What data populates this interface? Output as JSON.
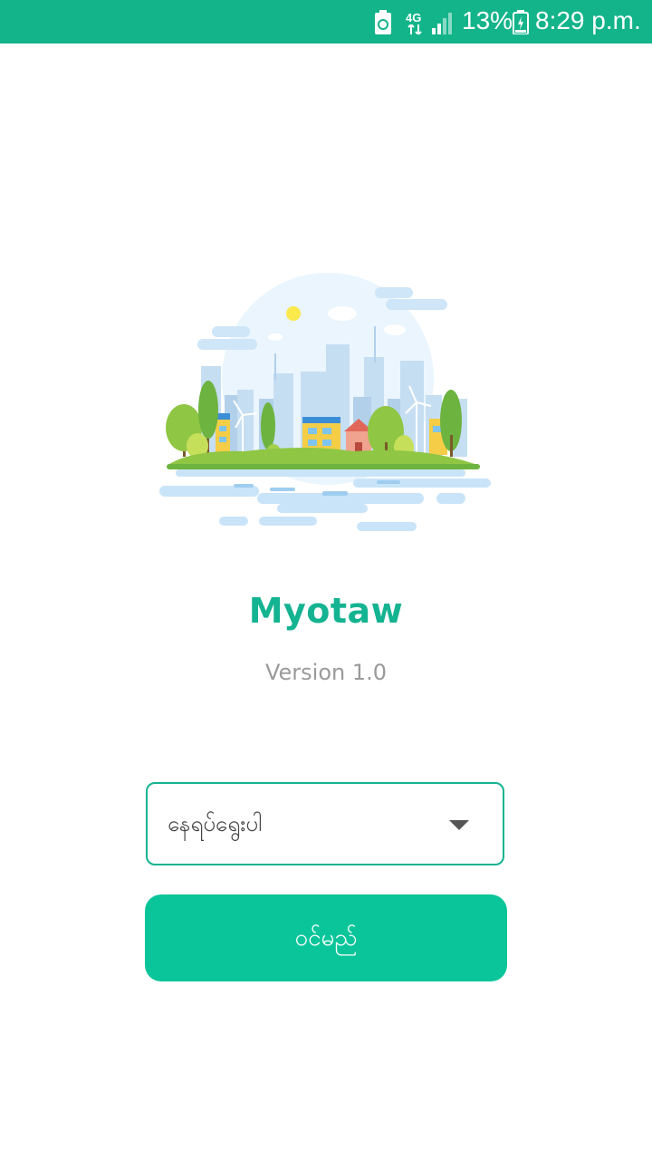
{
  "status_bar": {
    "network": "4G",
    "battery_percent": "13%",
    "time": "8:29 p.m."
  },
  "app": {
    "title": "Myotaw",
    "version": "Version 1.0"
  },
  "location_select": {
    "selected_label": "နေရပ်ရွေးပါ"
  },
  "enter_button": {
    "label": "ဝင်မည်"
  },
  "colors": {
    "status_bar": "#13b48a",
    "accent": "#14b391",
    "button": "#0bc59a",
    "version_text": "#9a9a9a"
  },
  "icons": [
    "battery-saver-icon",
    "network-4g-icon",
    "signal-icon",
    "battery-icon",
    "dropdown-arrow-icon",
    "city-illustration"
  ]
}
